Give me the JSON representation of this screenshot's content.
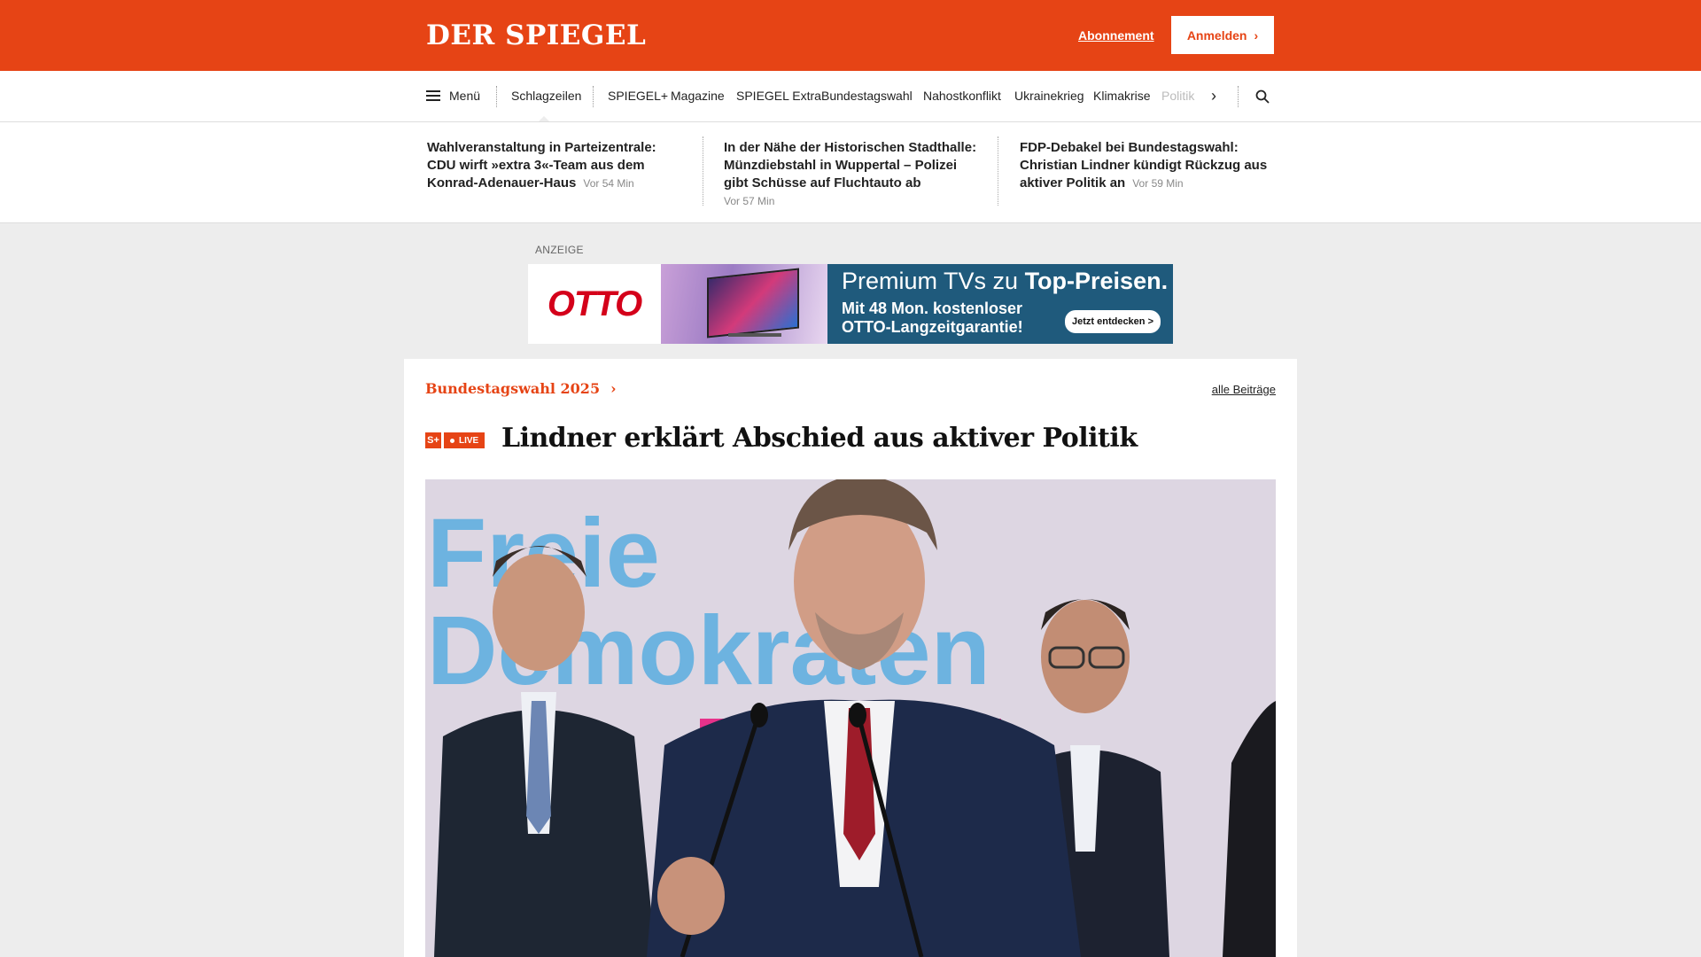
{
  "header": {
    "logo": "DER SPIEGEL",
    "abonnement": "Abonnement",
    "login": "Anmelden"
  },
  "nav": {
    "menu": "Menü",
    "items": [
      "Schlagzeilen",
      "SPIEGEL+",
      "Magazine",
      "SPIEGEL Extra",
      "Bundestagswahl",
      "Nahostkonflikt",
      "Ukrainekrieg",
      "Klimakrise",
      "Politik"
    ]
  },
  "teasers": [
    {
      "title": "Wahlveranstaltung in Parteizentrale: CDU wirft »extra 3«-Team aus dem Konrad-Adenauer-Haus",
      "time": "Vor 54 Min"
    },
    {
      "title": "In der Nähe der Historischen Stadthalle: Münzdiebstahl in Wuppertal – Polizei gibt Schüsse auf Fluchtauto ab",
      "time": "Vor 57 Min"
    },
    {
      "title": "FDP-Debakel bei Bundestagswahl: Christian Lindner kündigt Rückzug aus aktiver Politik an",
      "time": "Vor 59 Min"
    }
  ],
  "ad": {
    "label": "ANZEIGE",
    "brand": "OTTO",
    "headline_light": "Premium TVs zu ",
    "headline_bold": "Top-Preisen.",
    "line1": "Mit 48 Mon. kostenloser",
    "line2": "OTTO-Langzeitgarantie!",
    "button": "Jetzt entdecken >"
  },
  "article": {
    "kicker": "Bundestagswahl 2025",
    "all_posts": "alle Beiträge",
    "badge_s": "S+",
    "badge_live": "LIVE",
    "headline": "Lindner erklärt Abschied aus aktiver Politik",
    "photo_text_1": "Freie",
    "photo_text_2": "Demokraten"
  },
  "colors": {
    "brand": "#e64415",
    "ad_blue": "#1f5a7c"
  }
}
